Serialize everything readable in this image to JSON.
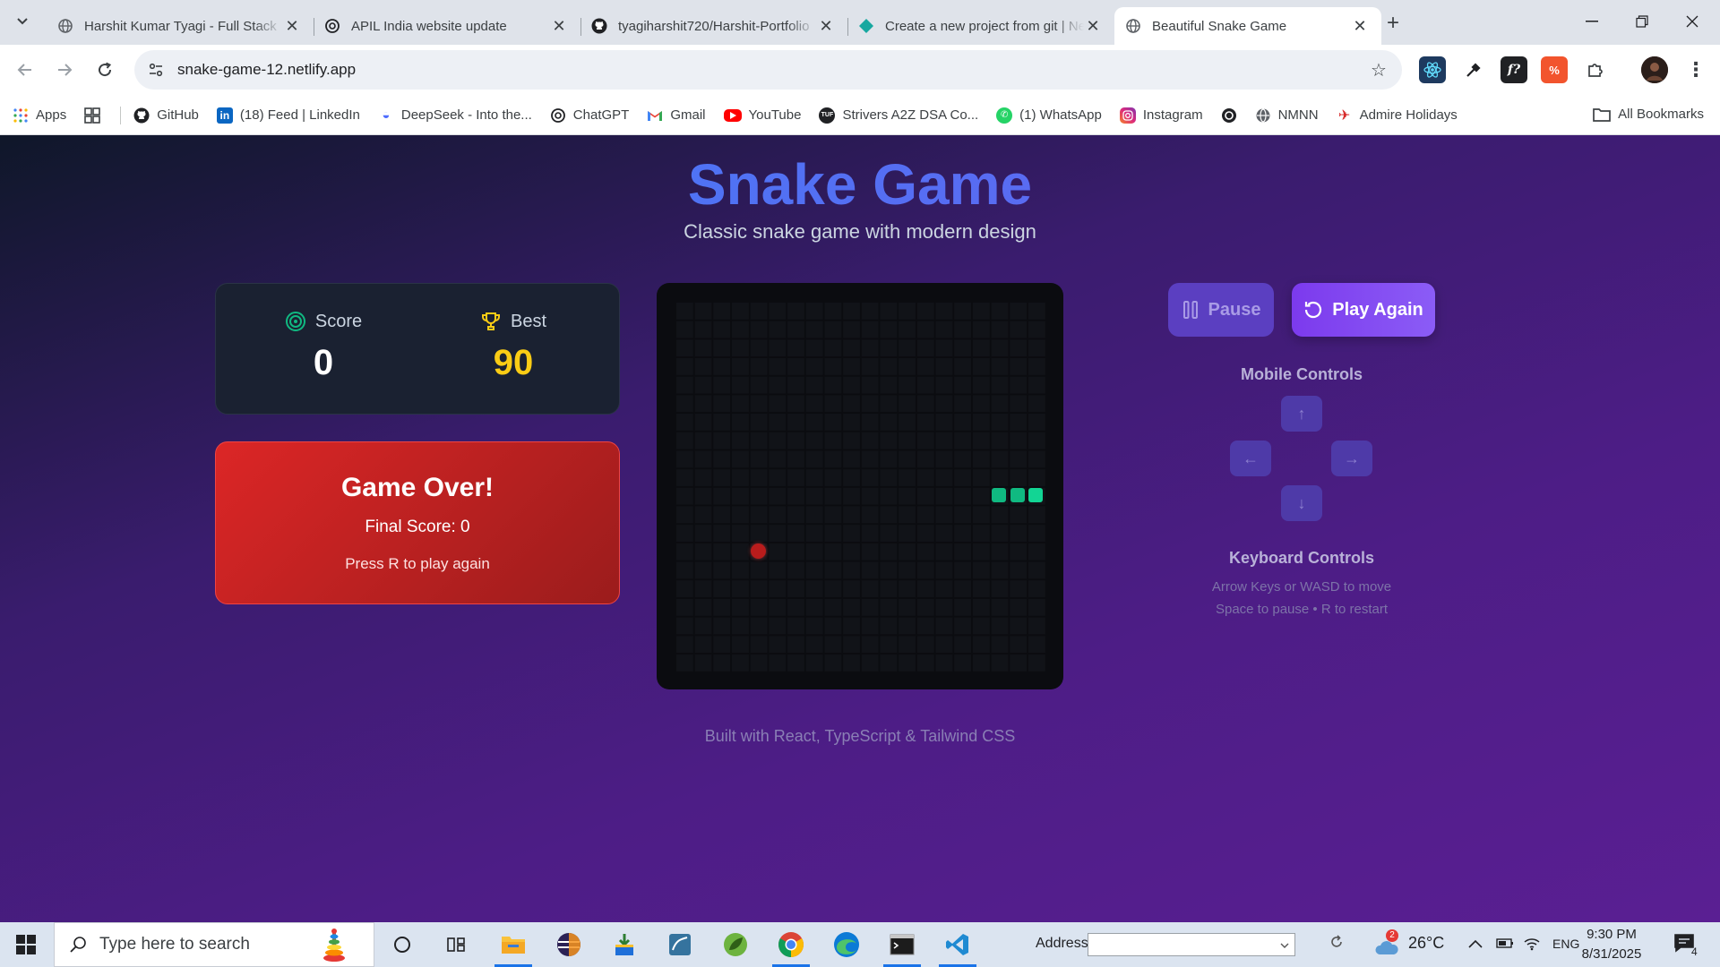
{
  "browser": {
    "tabs": [
      {
        "title": "Harshit Kumar Tyagi - Full Stack",
        "close": "✕"
      },
      {
        "title": "APIL India website update",
        "close": "✕"
      },
      {
        "title": "tyagiharshit720/Harshit-Portfolio",
        "close": "✕"
      },
      {
        "title": "Create a new project from git | Netlify",
        "close": "✕"
      },
      {
        "title": "Beautiful Snake Game",
        "close": "✕"
      }
    ],
    "new_tab": "+",
    "url": "snake-game-12.netlify.app",
    "bookmarks": [
      {
        "label": "Apps",
        "icon": "apps-grid-icon"
      },
      {
        "label": "GitHub",
        "icon": "github-icon"
      },
      {
        "label": "(18) Feed | LinkedIn",
        "icon": "linkedin-icon"
      },
      {
        "label": "DeepSeek - Into the...",
        "icon": "deepseek-icon"
      },
      {
        "label": "ChatGPT",
        "icon": "chatgpt-icon"
      },
      {
        "label": "Gmail",
        "icon": "gmail-icon"
      },
      {
        "label": "YouTube",
        "icon": "youtube-icon"
      },
      {
        "label": "Strivers A2Z DSA Co...",
        "icon": "tuf-icon"
      },
      {
        "label": "(1) WhatsApp",
        "icon": "whatsapp-icon"
      },
      {
        "label": "Instagram",
        "icon": "instagram-icon"
      },
      {
        "label": "NMNN",
        "icon": "globe-icon"
      },
      {
        "label": "Admire Holidays",
        "icon": "admire-icon"
      }
    ],
    "all_bookmarks": "All Bookmarks"
  },
  "game": {
    "title": "Snake Game",
    "subtitle": "Classic snake game with modern design",
    "score_label": "Score",
    "score": "0",
    "best_label": "Best",
    "best": "90",
    "game_over_title": "Game Over!",
    "final_score": "Final Score: 0",
    "restart_hint": "Press R to play again",
    "pause_label": "Pause",
    "play_again_label": "Play Again",
    "mobile_controls_title": "Mobile Controls",
    "arrows": {
      "up": "↑",
      "left": "←",
      "right": "→",
      "down": "↓"
    },
    "keyboard_controls_title": "Keyboard Controls",
    "keyboard_line1": "Arrow Keys or WASD to move",
    "keyboard_line2": "Space to pause • R to restart",
    "footer": "Built with React, TypeScript & Tailwind CSS",
    "board": {
      "grid_size": 20,
      "snake": [
        {
          "col": 19,
          "row": 10
        },
        {
          "col": 18,
          "row": 10
        },
        {
          "col": 17,
          "row": 10
        }
      ],
      "food": {
        "col": 4,
        "row": 13
      }
    },
    "colors": {
      "snake": "#10b981",
      "food": "#b91c1c",
      "best": "#facc15",
      "accent": "#7c3aed"
    }
  },
  "taskbar": {
    "search_placeholder": "Type here to search",
    "address_label": "Address",
    "weather_badge": "2",
    "temperature": "26°C",
    "language": "ENG",
    "time": "9:30 PM",
    "date": "8/31/2025",
    "notifications": "4"
  }
}
